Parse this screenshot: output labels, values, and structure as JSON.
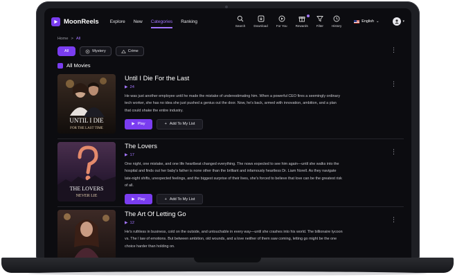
{
  "app": {
    "name": "MoonReels"
  },
  "nav": [
    {
      "label": "Explore"
    },
    {
      "label": "New"
    },
    {
      "label": "Categories",
      "active": true
    },
    {
      "label": "Ranking"
    }
  ],
  "tools": [
    {
      "label": "Search",
      "icon": "search-icon"
    },
    {
      "label": "Download",
      "icon": "download-icon"
    },
    {
      "label": "For You",
      "icon": "play-circle-icon"
    },
    {
      "label": "Rewards",
      "icon": "gift-icon"
    },
    {
      "label": "Filter",
      "icon": "filter-icon"
    },
    {
      "label": "History",
      "icon": "history-icon"
    }
  ],
  "language": {
    "label": "English"
  },
  "breadcrumb": {
    "home": "Home",
    "separator": ">",
    "current": "All"
  },
  "filters": [
    {
      "label": "All",
      "active": true
    },
    {
      "label": "Mystery",
      "icon": "mystery-icon"
    },
    {
      "label": "Crime",
      "icon": "crime-icon"
    }
  ],
  "section": {
    "title": "All Movies"
  },
  "buttons": {
    "play": "Play",
    "add": "Add To My List"
  },
  "movies": [
    {
      "title": "Until I Die For the Last",
      "episodes": "24",
      "description": "He was just another employee until he made the mistake of underestimating him. When a powerful CEO fires a seemingly ordinary tech worker, she has no idea she just pushed a genius out the door. Now, he's back, armed with innovation, ambition, and a plan that could shake the entire industry.",
      "poster_line1": "UNTIL I DIE",
      "poster_line2": "FOR THE LAST TIME"
    },
    {
      "title": "The Lovers",
      "episodes": "17",
      "description": "One night, one mistake, and one life heartbeat changed everything. The nows expected to see him again—until she walks into the hospital and finds out her baby's father is none other than the brilliant and infamously heartless Dr. Liam Norell. As they navigate late-night shifts, unexpected feelings, and the biggest surprise of their lives, she's forced to believe that love can be the greatest risk of all.",
      "poster_line1": "THE LOVERS",
      "poster_line2": "NEVER LIE"
    },
    {
      "title": "The Art Of Letting Go",
      "episodes": "12",
      "description": "He's ruthless in business, cold on the outside, and untouchable in every way—until she crashes into his world. The billionaire tycoon vs. The l law of emotions. But between ambition, old wounds, and a love neither of them saw coming, letting go might be the one choice harder than holding on.",
      "poster_line1": "",
      "poster_line2": ""
    }
  ],
  "colors": {
    "accent": "#7a3df0",
    "accent_text": "#a375ff",
    "background": "#0c0c10"
  }
}
